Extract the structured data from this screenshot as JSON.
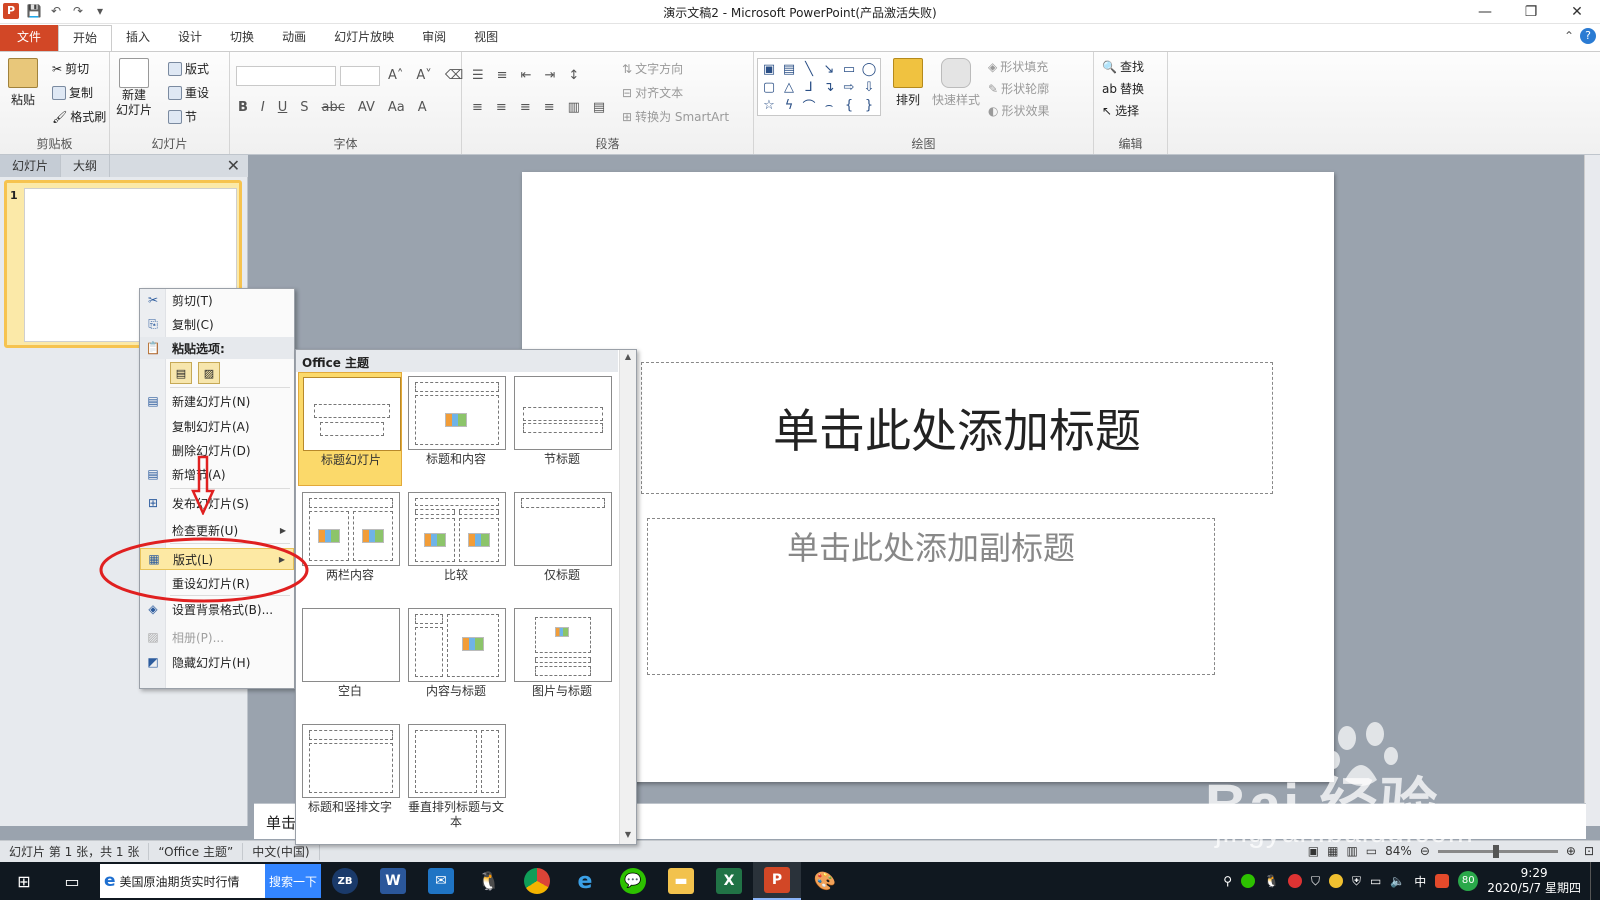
{
  "titlebar": {
    "app_icon_letter": "P",
    "title": "演示文稿2 - Microsoft PowerPoint(产品激活失败)",
    "qat": [
      "save-icon",
      "undo-icon",
      "redo-icon",
      "customize-icon"
    ],
    "controls": [
      "minimize",
      "restore",
      "close"
    ]
  },
  "tabs": [
    "文件",
    "开始",
    "插入",
    "设计",
    "切换",
    "动画",
    "幻灯片放映",
    "审阅",
    "视图"
  ],
  "active_tab": "开始",
  "ribbon": {
    "clipboard": {
      "paste": "粘贴",
      "cut": "剪切",
      "copy": "复制",
      "format_painter": "格式刷",
      "label": "剪贴板"
    },
    "slides": {
      "new_slide_line1": "新建",
      "new_slide_line2": "幻灯片",
      "layout": "版式",
      "reset": "重设",
      "section": "节",
      "label": "幻灯片"
    },
    "font": {
      "label": "字体"
    },
    "paragraph": {
      "text_direction": "文字方向",
      "align_text": "对齐文本",
      "smartart": "转换为 SmartArt",
      "label": "段落"
    },
    "drawing": {
      "arrange": "排列",
      "quick_styles": "快速样式",
      "shape_fill": "形状填充",
      "shape_outline": "形状轮廓",
      "shape_effects": "形状效果",
      "label": "绘图"
    },
    "editing": {
      "find": "查找",
      "replace": "替换",
      "select": "选择",
      "label": "编辑"
    }
  },
  "left_panel": {
    "tabs": [
      "幻灯片",
      "大纲"
    ],
    "slide_number": "1"
  },
  "slide": {
    "title_placeholder": "单击此处添加标题",
    "subtitle_placeholder": "单击此处添加副标题"
  },
  "notes_text": "单击",
  "context_menu": {
    "cut": "剪切(T)",
    "copy": "复制(C)",
    "paste_options": "粘贴选项:",
    "new_slide": "新建幻灯片(N)",
    "duplicate_slide": "复制幻灯片(A)",
    "delete_slide": "删除幻灯片(D)",
    "new_section": "新增节(A)",
    "publish_slides": "发布幻灯片(S)",
    "check_updates": "检查更新(U)",
    "layout": "版式(L)",
    "reset_slide": "重设幻灯片(R)",
    "format_background": "设置背景格式(B)...",
    "photo_album": "相册(P)...",
    "hide_slide": "隐藏幻灯片(H)"
  },
  "layout_gallery": {
    "header": "Office 主题",
    "selected": "标题幻灯片",
    "items": [
      "标题幻灯片",
      "标题和内容",
      "节标题",
      "两栏内容",
      "比较",
      "仅标题",
      "空白",
      "内容与标题",
      "图片与标题",
      "标题和竖排文字",
      "垂直排列标题与文本"
    ]
  },
  "statusbar": {
    "slide_info": "幻灯片 第 1 张，共 1 张",
    "theme": "“Office 主题”",
    "language": "中文(中国)",
    "zoom": "84%"
  },
  "taskbar": {
    "search_text": "美国原油期货实时行情",
    "search_button": "搜索一下",
    "time": "9:29",
    "date": "2020/5/7 星期四",
    "ime": "中",
    "badge": "80"
  },
  "watermark": {
    "main": "Bai 经验",
    "sub": "jingyan.baidu.com"
  },
  "colors": {
    "file_tab": "#d24726",
    "selection": "#fbd96a",
    "annotation": "#e02020"
  }
}
